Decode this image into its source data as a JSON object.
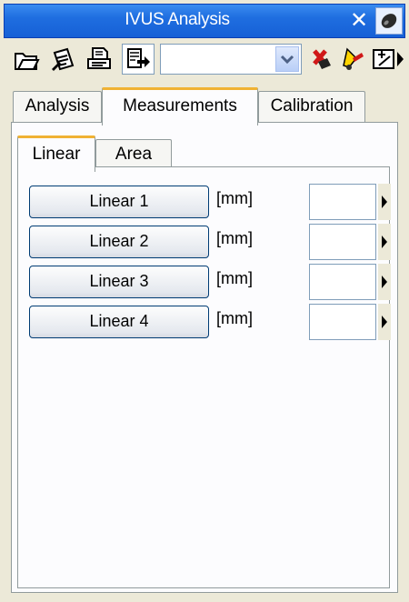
{
  "window": {
    "title": "IVUS Analysis",
    "close_symbol": "✕",
    "pin_icon": "pin-icon"
  },
  "toolbar": {
    "icons": [
      "open-folder-icon",
      "edit-document-icon",
      "print-document-icon",
      "export-icon",
      "delete-red-icon",
      "highlight-icon",
      "add-measurement-icon",
      "more-arrow-icon"
    ],
    "combo_value": ""
  },
  "tabs": [
    "Analysis",
    "Measurements",
    "Calibration"
  ],
  "active_tab": "Measurements",
  "sub_tabs": [
    "Linear",
    "Area"
  ],
  "active_sub_tab": "Linear",
  "measurements": [
    {
      "label": "Linear 1",
      "unit": "[mm]",
      "value": ""
    },
    {
      "label": "Linear 2",
      "unit": "[mm]",
      "value": ""
    },
    {
      "label": "Linear 3",
      "unit": "[mm]",
      "value": ""
    },
    {
      "label": "Linear 4",
      "unit": "[mm]",
      "value": ""
    }
  ],
  "colors": {
    "titlebar": "#1f6ee0",
    "active_tab_accent": "#f0b233",
    "button_border": "#003c74"
  }
}
